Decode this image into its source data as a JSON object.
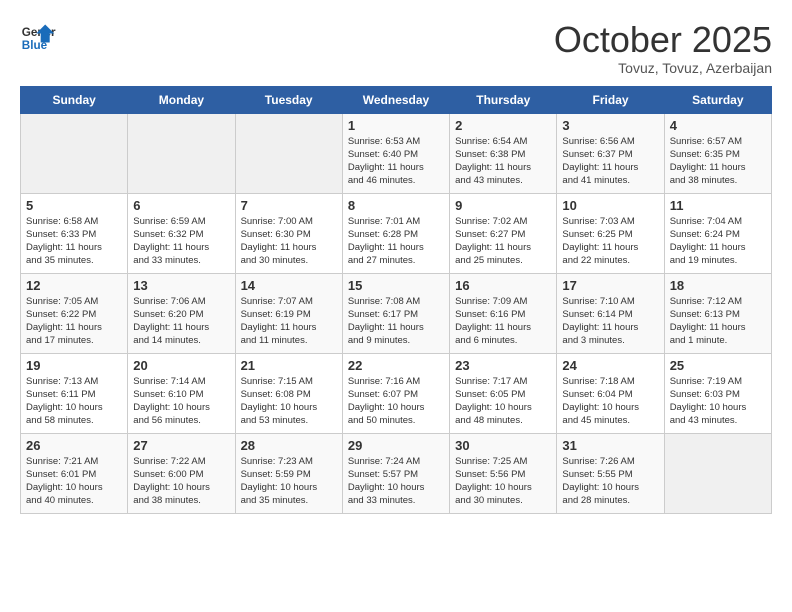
{
  "header": {
    "logo_line1": "General",
    "logo_line2": "Blue",
    "month": "October 2025",
    "location": "Tovuz, Tovuz, Azerbaijan"
  },
  "days_of_week": [
    "Sunday",
    "Monday",
    "Tuesday",
    "Wednesday",
    "Thursday",
    "Friday",
    "Saturday"
  ],
  "weeks": [
    [
      {
        "day": "",
        "info": ""
      },
      {
        "day": "",
        "info": ""
      },
      {
        "day": "",
        "info": ""
      },
      {
        "day": "1",
        "info": "Sunrise: 6:53 AM\nSunset: 6:40 PM\nDaylight: 11 hours\nand 46 minutes."
      },
      {
        "day": "2",
        "info": "Sunrise: 6:54 AM\nSunset: 6:38 PM\nDaylight: 11 hours\nand 43 minutes."
      },
      {
        "day": "3",
        "info": "Sunrise: 6:56 AM\nSunset: 6:37 PM\nDaylight: 11 hours\nand 41 minutes."
      },
      {
        "day": "4",
        "info": "Sunrise: 6:57 AM\nSunset: 6:35 PM\nDaylight: 11 hours\nand 38 minutes."
      }
    ],
    [
      {
        "day": "5",
        "info": "Sunrise: 6:58 AM\nSunset: 6:33 PM\nDaylight: 11 hours\nand 35 minutes."
      },
      {
        "day": "6",
        "info": "Sunrise: 6:59 AM\nSunset: 6:32 PM\nDaylight: 11 hours\nand 33 minutes."
      },
      {
        "day": "7",
        "info": "Sunrise: 7:00 AM\nSunset: 6:30 PM\nDaylight: 11 hours\nand 30 minutes."
      },
      {
        "day": "8",
        "info": "Sunrise: 7:01 AM\nSunset: 6:28 PM\nDaylight: 11 hours\nand 27 minutes."
      },
      {
        "day": "9",
        "info": "Sunrise: 7:02 AM\nSunset: 6:27 PM\nDaylight: 11 hours\nand 25 minutes."
      },
      {
        "day": "10",
        "info": "Sunrise: 7:03 AM\nSunset: 6:25 PM\nDaylight: 11 hours\nand 22 minutes."
      },
      {
        "day": "11",
        "info": "Sunrise: 7:04 AM\nSunset: 6:24 PM\nDaylight: 11 hours\nand 19 minutes."
      }
    ],
    [
      {
        "day": "12",
        "info": "Sunrise: 7:05 AM\nSunset: 6:22 PM\nDaylight: 11 hours\nand 17 minutes."
      },
      {
        "day": "13",
        "info": "Sunrise: 7:06 AM\nSunset: 6:20 PM\nDaylight: 11 hours\nand 14 minutes."
      },
      {
        "day": "14",
        "info": "Sunrise: 7:07 AM\nSunset: 6:19 PM\nDaylight: 11 hours\nand 11 minutes."
      },
      {
        "day": "15",
        "info": "Sunrise: 7:08 AM\nSunset: 6:17 PM\nDaylight: 11 hours\nand 9 minutes."
      },
      {
        "day": "16",
        "info": "Sunrise: 7:09 AM\nSunset: 6:16 PM\nDaylight: 11 hours\nand 6 minutes."
      },
      {
        "day": "17",
        "info": "Sunrise: 7:10 AM\nSunset: 6:14 PM\nDaylight: 11 hours\nand 3 minutes."
      },
      {
        "day": "18",
        "info": "Sunrise: 7:12 AM\nSunset: 6:13 PM\nDaylight: 11 hours\nand 1 minute."
      }
    ],
    [
      {
        "day": "19",
        "info": "Sunrise: 7:13 AM\nSunset: 6:11 PM\nDaylight: 10 hours\nand 58 minutes."
      },
      {
        "day": "20",
        "info": "Sunrise: 7:14 AM\nSunset: 6:10 PM\nDaylight: 10 hours\nand 56 minutes."
      },
      {
        "day": "21",
        "info": "Sunrise: 7:15 AM\nSunset: 6:08 PM\nDaylight: 10 hours\nand 53 minutes."
      },
      {
        "day": "22",
        "info": "Sunrise: 7:16 AM\nSunset: 6:07 PM\nDaylight: 10 hours\nand 50 minutes."
      },
      {
        "day": "23",
        "info": "Sunrise: 7:17 AM\nSunset: 6:05 PM\nDaylight: 10 hours\nand 48 minutes."
      },
      {
        "day": "24",
        "info": "Sunrise: 7:18 AM\nSunset: 6:04 PM\nDaylight: 10 hours\nand 45 minutes."
      },
      {
        "day": "25",
        "info": "Sunrise: 7:19 AM\nSunset: 6:03 PM\nDaylight: 10 hours\nand 43 minutes."
      }
    ],
    [
      {
        "day": "26",
        "info": "Sunrise: 7:21 AM\nSunset: 6:01 PM\nDaylight: 10 hours\nand 40 minutes."
      },
      {
        "day": "27",
        "info": "Sunrise: 7:22 AM\nSunset: 6:00 PM\nDaylight: 10 hours\nand 38 minutes."
      },
      {
        "day": "28",
        "info": "Sunrise: 7:23 AM\nSunset: 5:59 PM\nDaylight: 10 hours\nand 35 minutes."
      },
      {
        "day": "29",
        "info": "Sunrise: 7:24 AM\nSunset: 5:57 PM\nDaylight: 10 hours\nand 33 minutes."
      },
      {
        "day": "30",
        "info": "Sunrise: 7:25 AM\nSunset: 5:56 PM\nDaylight: 10 hours\nand 30 minutes."
      },
      {
        "day": "31",
        "info": "Sunrise: 7:26 AM\nSunset: 5:55 PM\nDaylight: 10 hours\nand 28 minutes."
      },
      {
        "day": "",
        "info": ""
      }
    ]
  ]
}
